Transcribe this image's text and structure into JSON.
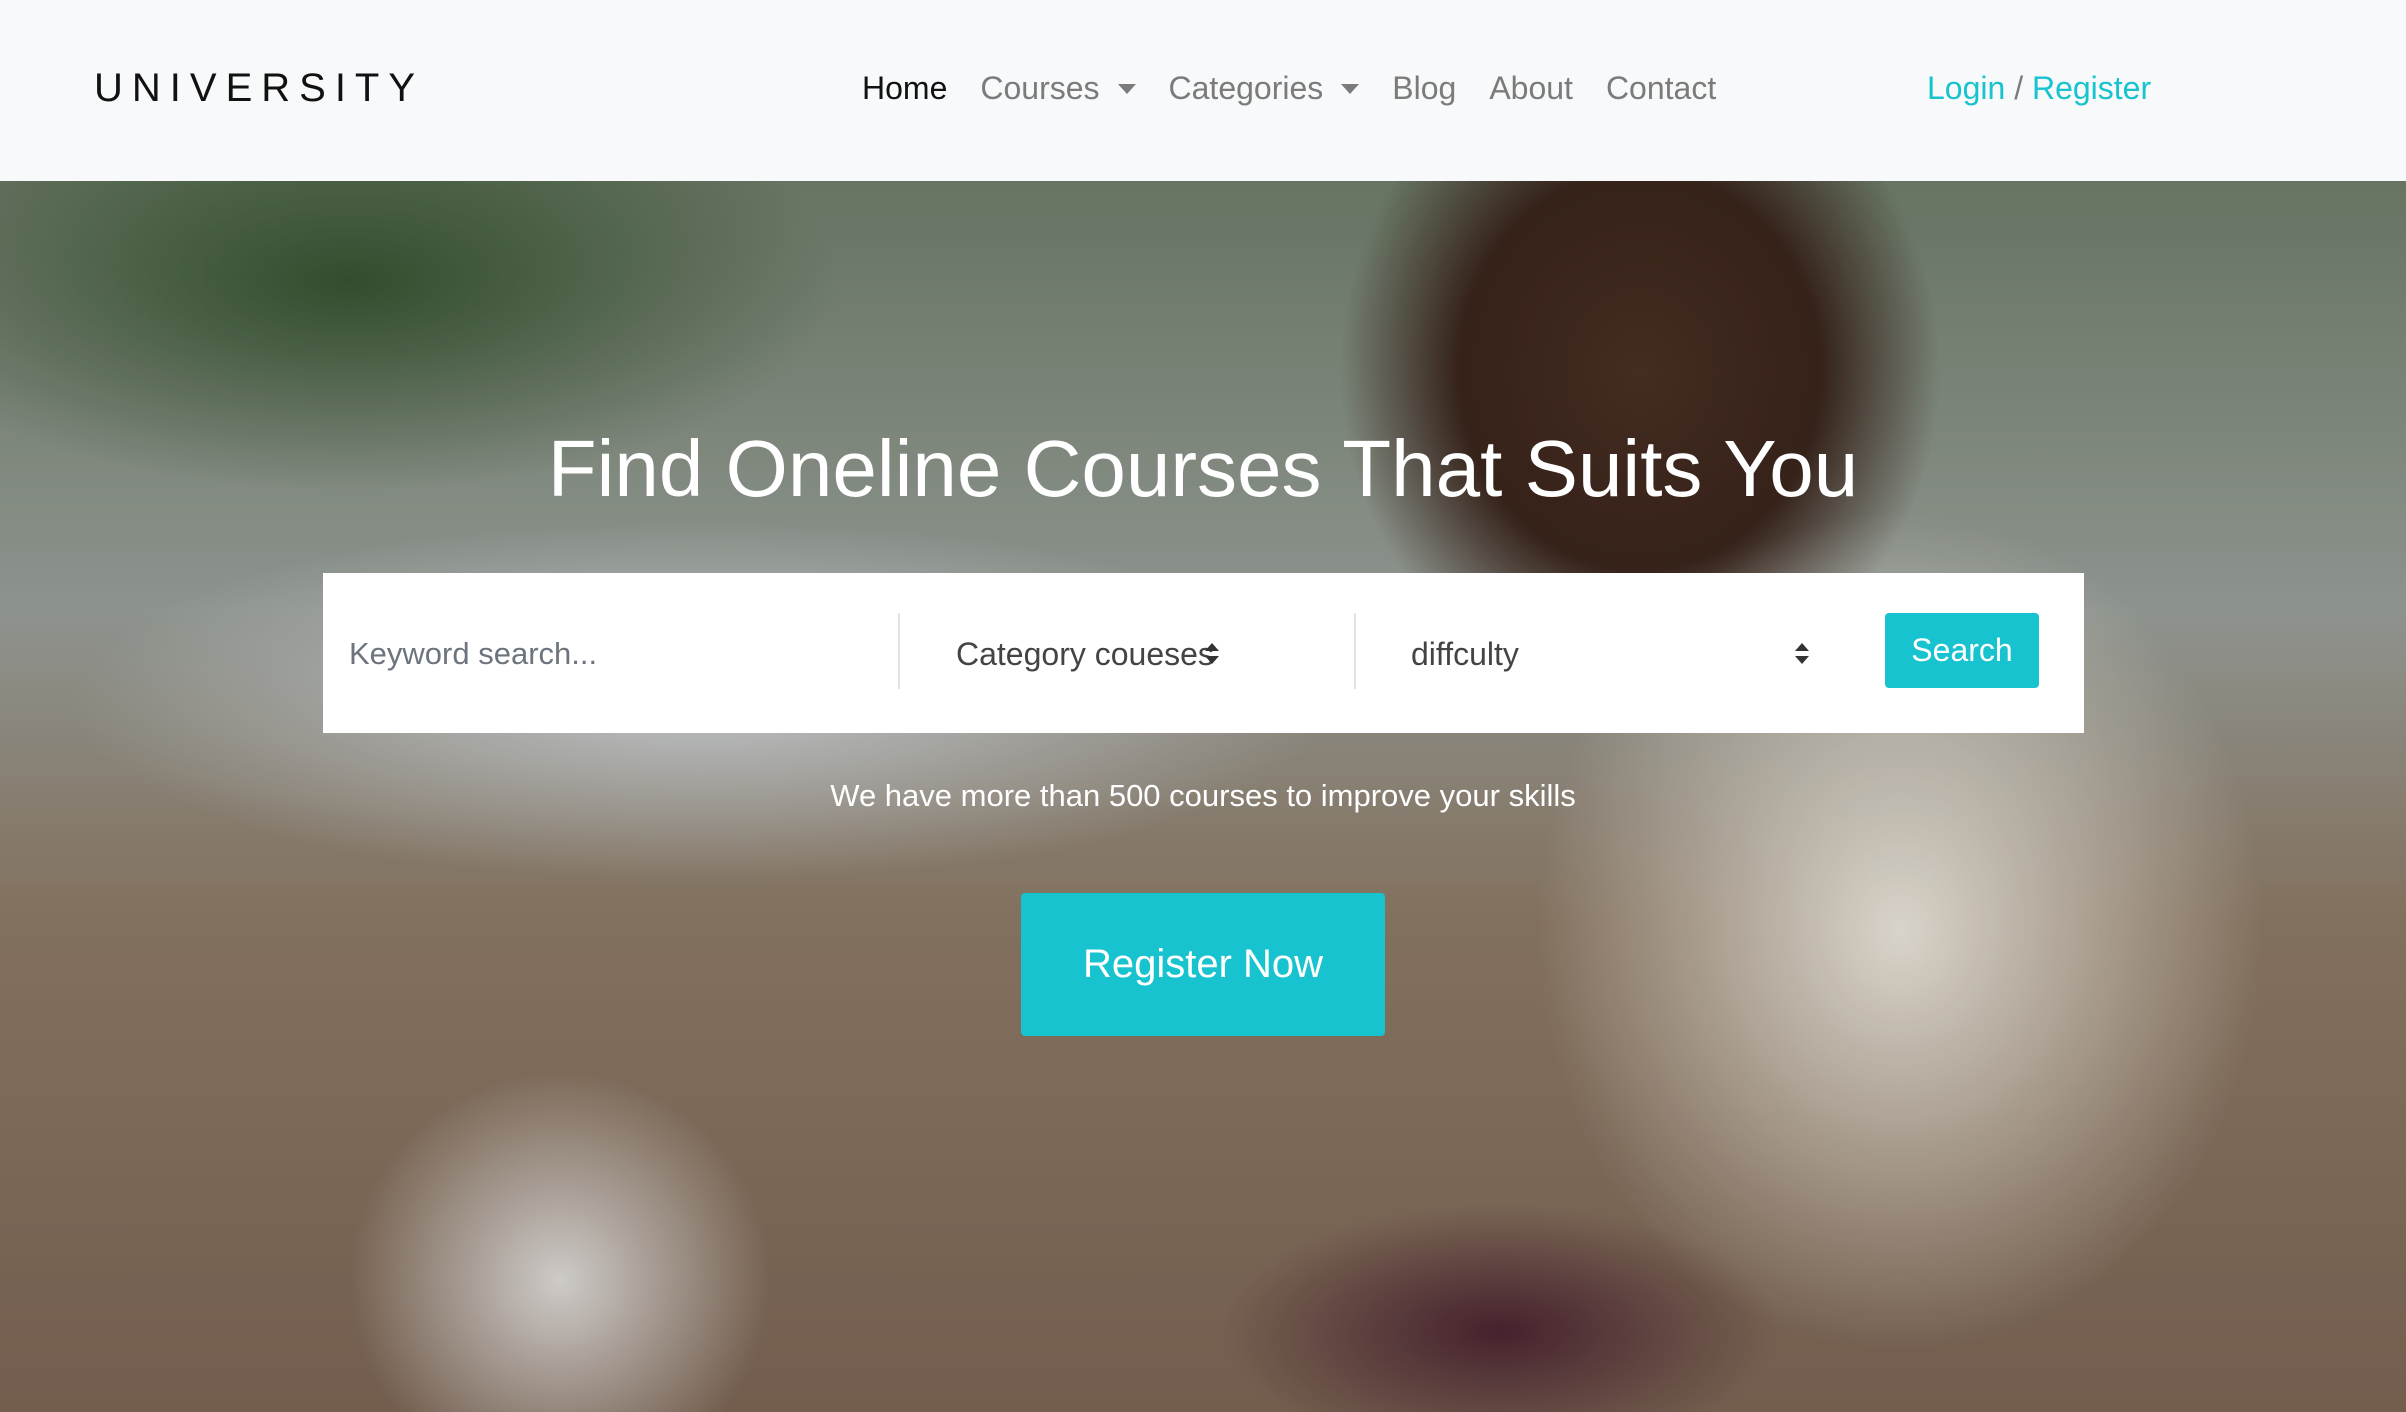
{
  "brand": "UNIVERSITY",
  "nav": {
    "home": "Home",
    "courses": "Courses",
    "categories": "Categories",
    "blog": "Blog",
    "about": "About",
    "contact": "Contact"
  },
  "auth": {
    "login": "Login",
    "separator": "/",
    "register": "Register"
  },
  "hero": {
    "title": "Find Oneline Courses That Suits You",
    "search": {
      "keyword_placeholder": "Keyword search...",
      "category_selected": "Category coueses",
      "difficulty_selected": "diffculty",
      "button_label": "Search"
    },
    "tagline": "We have more than 500 courses to improve your skills",
    "cta_label": "Register Now"
  },
  "colors": {
    "accent": "#17c3cf",
    "navbar_bg": "#f8f9fa",
    "nav_text": "#7b7b7b"
  }
}
